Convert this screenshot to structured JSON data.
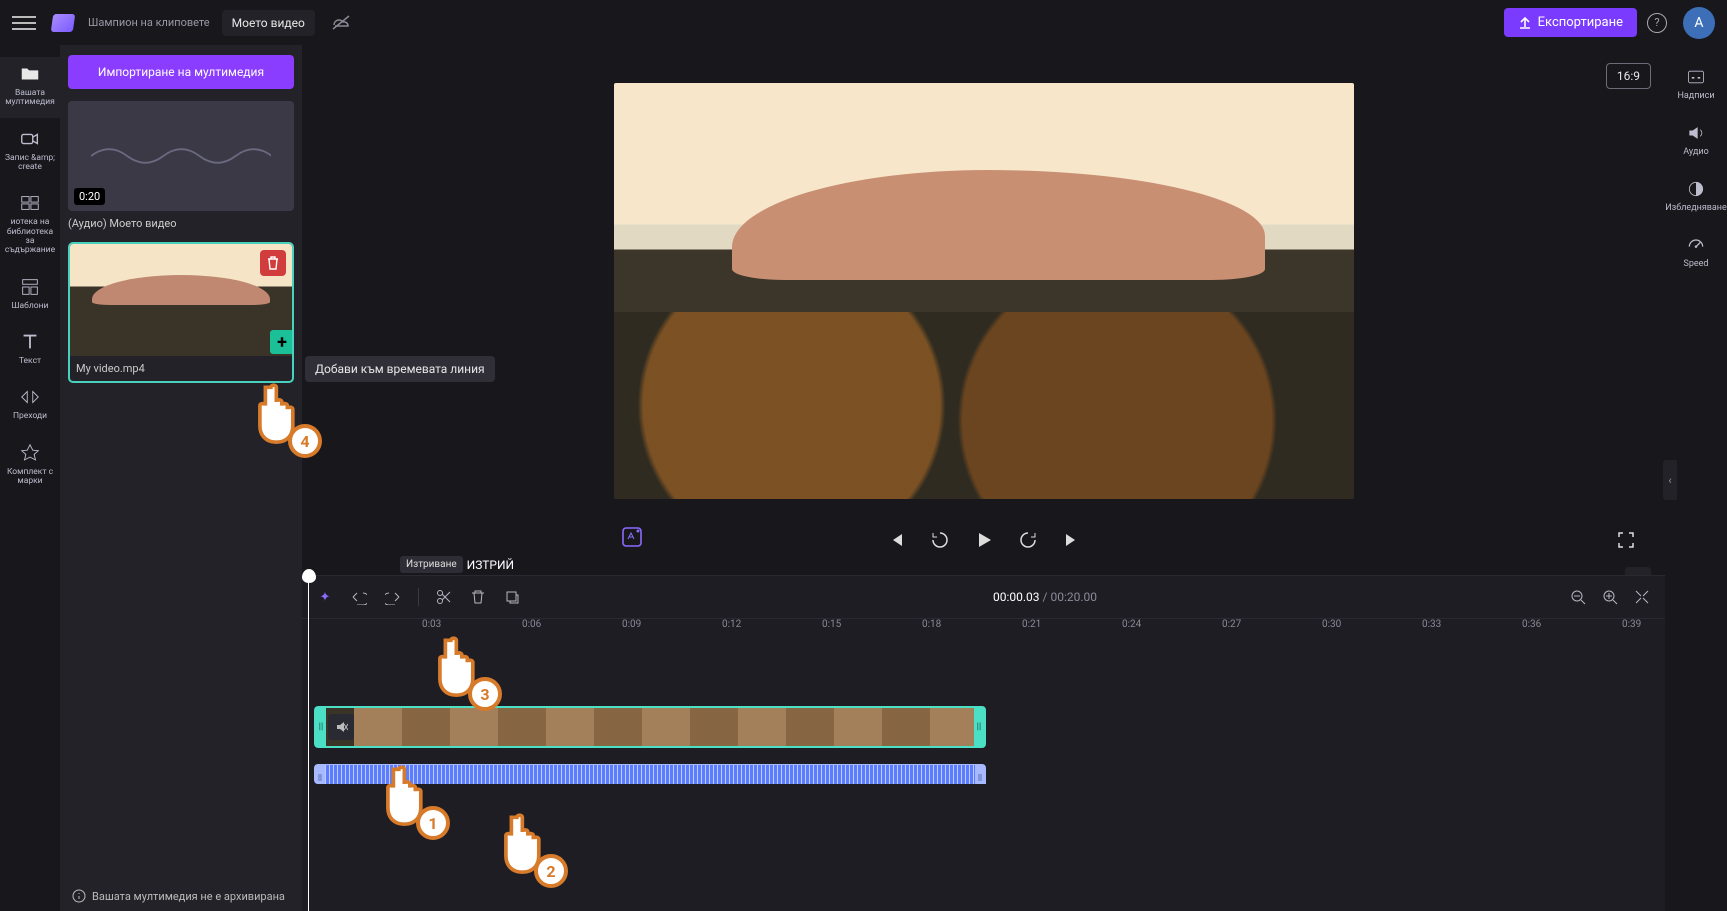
{
  "topbar": {
    "app_subtitle": "Шампион на клиповете",
    "project_name": "Моето видео",
    "export_label": "Експортиране",
    "avatar_letter": "A",
    "help_char": "?"
  },
  "nav": [
    {
      "key": "your-media",
      "label": "Вашата мултимедия"
    },
    {
      "key": "record-create",
      "label": "Запис &amp;\ncreate"
    },
    {
      "key": "content-library",
      "label": "иотека на библиотека\nза съдържание"
    },
    {
      "key": "templates",
      "label": "Шаблони"
    },
    {
      "key": "text",
      "label": "Текст"
    },
    {
      "key": "transitions",
      "label": "Преходи"
    },
    {
      "key": "brand-kit",
      "label": "Комплект с марки"
    }
  ],
  "media_panel": {
    "import_label": "Импортиране на мултимедия",
    "audio_item": {
      "label": "(Аудио) Моето видео",
      "duration": "0:20"
    },
    "video_item": {
      "label": "My video.mp4"
    },
    "add_tooltip": "Добави към времевата линия",
    "archive_warning": "Вашата мултимедия не е архивирана"
  },
  "delete_tooltip": {
    "tag": "Изтриване",
    "main": "ИЗТРИЙ"
  },
  "preview": {
    "aspect": "16:9"
  },
  "timeline": {
    "current": "00:00.03",
    "total": "00:20.00",
    "ticks": [
      "0:03",
      "0:06",
      "0:09",
      "0:12",
      "0:15",
      "0:18",
      "0:21",
      "0:24",
      "0:27",
      "0:30",
      "0:33",
      "0:36",
      "0:39"
    ]
  },
  "right_rail": [
    {
      "key": "captions",
      "label": "Надписи"
    },
    {
      "key": "audio",
      "label": "Аудио"
    },
    {
      "key": "fade",
      "label": "Избледняване"
    },
    {
      "key": "speed",
      "label": "Speed"
    }
  ],
  "steps": {
    "s1": "1",
    "s2": "2",
    "s3": "3",
    "s4": "4"
  }
}
